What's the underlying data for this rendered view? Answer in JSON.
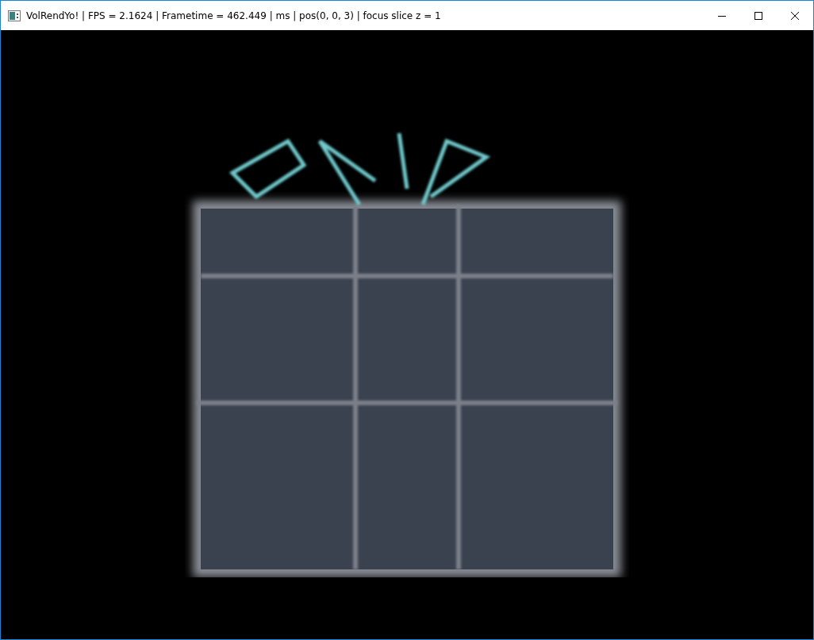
{
  "window": {
    "title": "VolRendYo! | FPS = 2.1624 | Frametime = 462.449 | ms | pos(0, 0, 3) | focus slice z = 1"
  }
}
